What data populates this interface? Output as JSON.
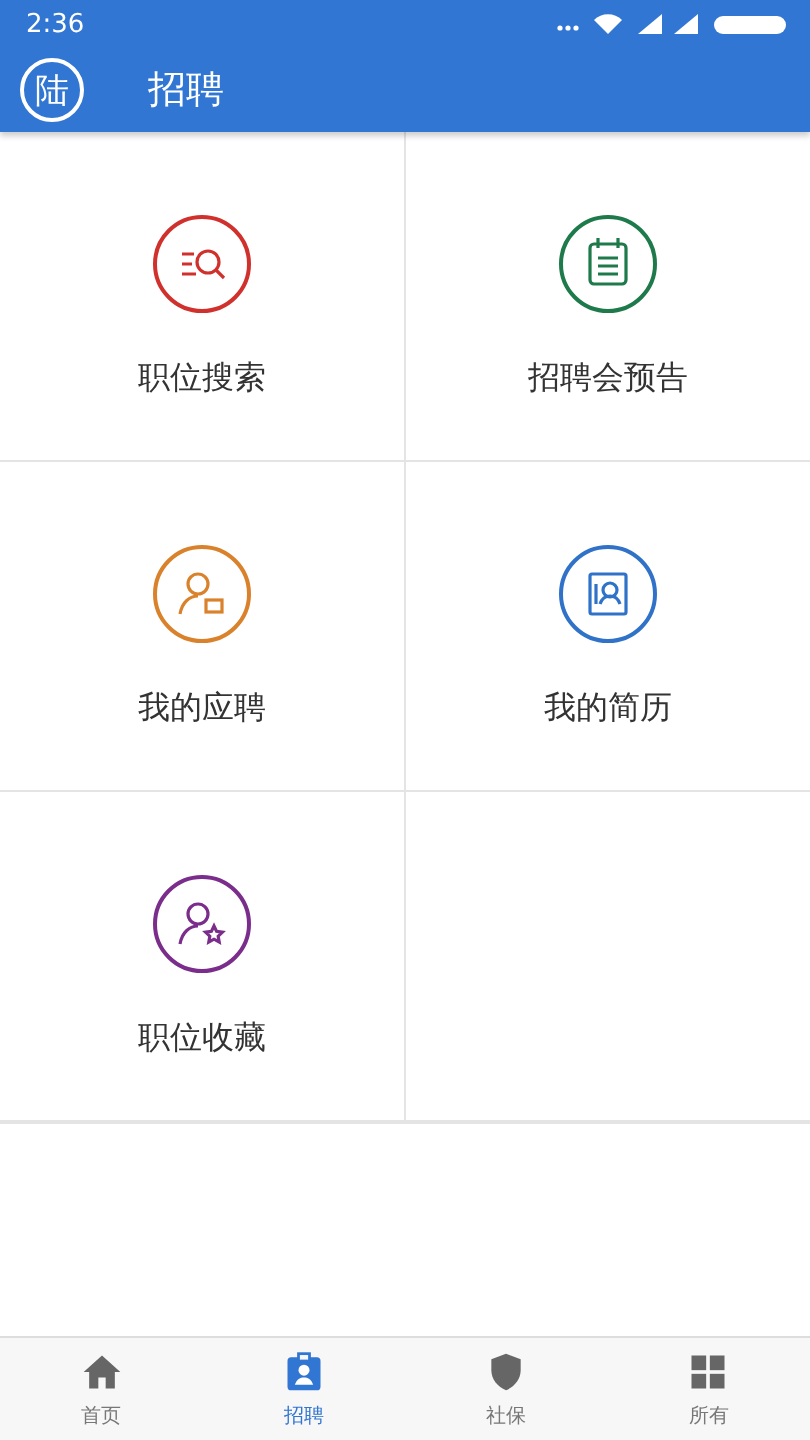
{
  "status_bar": {
    "time": "2:36"
  },
  "app_bar": {
    "logo": "陆",
    "title": "招聘"
  },
  "tiles": [
    {
      "label": "职位搜索",
      "kind": "search",
      "color": "#d0312d"
    },
    {
      "label": "招聘会预告",
      "kind": "calendar",
      "color": "#1e7a4a"
    },
    {
      "label": "我的应聘",
      "kind": "applicant",
      "color": "#d9822b"
    },
    {
      "label": "我的简历",
      "kind": "resume",
      "color": "#2f72c8"
    },
    {
      "label": "职位收藏",
      "kind": "favorite",
      "color": "#7b2d8b"
    }
  ],
  "bottom_nav": [
    {
      "label": "首页",
      "kind": "home",
      "selected": false
    },
    {
      "label": "招聘",
      "kind": "badge",
      "selected": true
    },
    {
      "label": "社保",
      "kind": "shield",
      "selected": false
    },
    {
      "label": "所有",
      "kind": "grid",
      "selected": false
    }
  ]
}
